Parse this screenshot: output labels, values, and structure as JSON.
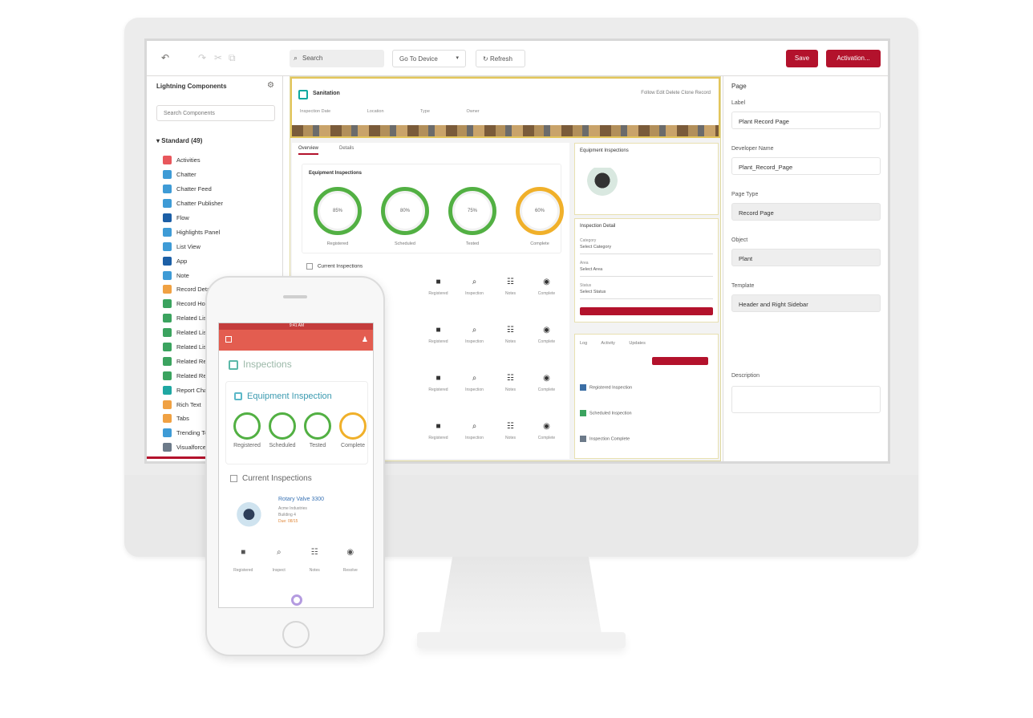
{
  "toolbar": {
    "back_icon": "undo-icon",
    "search_text": "Search",
    "device_select": "Go To Device",
    "refresh_label": "Refresh",
    "save_label": "Save",
    "activation_label": "Activation..."
  },
  "left_panel": {
    "title": "Lightning Components",
    "search_placeholder": "Search Components",
    "section": "Standard (49)",
    "items": [
      {
        "label": "Activities",
        "color": "#e8575c"
      },
      {
        "label": "Chatter",
        "color": "#3e9bd6"
      },
      {
        "label": "Chatter Feed",
        "color": "#3e9bd6"
      },
      {
        "label": "Chatter Publisher",
        "color": "#3e9bd6"
      },
      {
        "label": "Flow",
        "color": "#1c5fa6"
      },
      {
        "label": "Highlights Panel",
        "color": "#3e9bd6"
      },
      {
        "label": "List View",
        "color": "#3e9bd6"
      },
      {
        "label": "App",
        "color": "#1c5fa6"
      },
      {
        "label": "Note",
        "color": "#3e9bd6"
      },
      {
        "label": "Record Detail",
        "color": "#f0a143"
      },
      {
        "label": "Record Home",
        "color": "#3ba35f"
      },
      {
        "label": "Related List",
        "color": "#3ba35f"
      },
      {
        "label": "Related List Quick Links",
        "color": "#3ba35f"
      },
      {
        "label": "Related Lists",
        "color": "#3ba35f"
      },
      {
        "label": "Related Record",
        "color": "#3ba35f"
      },
      {
        "label": "Related Record List",
        "color": "#3ba35f"
      },
      {
        "label": "Report Chart",
        "color": "#1fa7a2"
      },
      {
        "label": "Rich Text",
        "color": "#f0a143"
      },
      {
        "label": "Tabs",
        "color": "#f0a143"
      },
      {
        "label": "Trending Topics",
        "color": "#3e9bd6"
      },
      {
        "label": "Visualforce",
        "color": "#6c7a89"
      }
    ]
  },
  "canvas": {
    "header": {
      "record_name": "Sanitation",
      "actions": "Follow   Edit   Delete   Clone Record",
      "fields": [
        "Inspection Date",
        "Location",
        "Type",
        "Owner"
      ]
    },
    "tabs": [
      "Overview",
      "Details"
    ],
    "inspection_card": {
      "title": "Equipment Inspections",
      "rings": [
        {
          "label": "Registered",
          "value": "85%",
          "color": "#52b043"
        },
        {
          "label": "Scheduled",
          "value": "80%",
          "color": "#52b043"
        },
        {
          "label": "Tested",
          "value": "75%",
          "color": "#52b043"
        },
        {
          "label": "Complete",
          "value": "60%",
          "color": "#f0b02a"
        }
      ]
    },
    "recent_label": "Current Inspections",
    "grid_labels": [
      "Registered",
      "Inspection",
      "Notes",
      "Complete"
    ],
    "side1_title": "Equipment Inspections",
    "side2": {
      "title": "Inspection Detail",
      "fields": [
        {
          "label": "Category",
          "value": "Select Category"
        },
        {
          "label": "Area",
          "value": "Select Area"
        },
        {
          "label": "Status",
          "value": "Select Status"
        }
      ]
    },
    "side3": {
      "tabs": [
        "Log",
        "Activity",
        "Updates"
      ],
      "activities": [
        "Registered Inspection",
        "Scheduled Inspection",
        "Inspection Complete"
      ]
    }
  },
  "right_panel": {
    "title": "Page",
    "fields": [
      {
        "label": "Label",
        "value": "Plant Record Page",
        "grey": false
      },
      {
        "label": "Developer Name",
        "value": "Plant_Record_Page",
        "grey": false
      },
      {
        "label": "Page Type",
        "value": "Record Page",
        "grey": true
      },
      {
        "label": "Object",
        "value": "Plant",
        "grey": true
      },
      {
        "label": "Template",
        "value": "Header and Right Sidebar",
        "grey": true
      }
    ],
    "description_label": "Description"
  },
  "phone": {
    "status_text": "9:41 AM",
    "app_title": "Inspections",
    "card_title": "Equipment Inspection",
    "rings": [
      {
        "label": "Registered",
        "color": "#52b043"
      },
      {
        "label": "Scheduled",
        "color": "#52b043"
      },
      {
        "label": "Tested",
        "color": "#52b043"
      },
      {
        "label": "Complete",
        "color": "#f0b02a"
      }
    ],
    "recent_title": "Current Inspections",
    "item": {
      "title": "Rotary Valve 3300",
      "subs": [
        "Acme Industries",
        "Building 4",
        "Due: 08/15"
      ]
    },
    "icon_labels": [
      "Registered",
      "Inspect",
      "Notes",
      "Resolve"
    ]
  }
}
